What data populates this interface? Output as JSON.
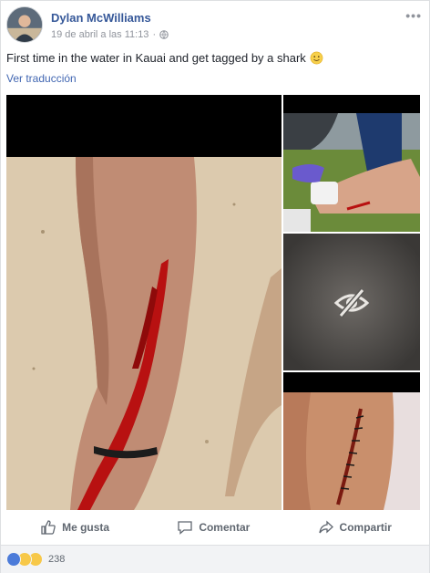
{
  "post": {
    "author": "Dylan McWilliams",
    "timestamp": "19 de abril a las 11:13",
    "privacy_icon": "globe-icon",
    "text": "First time in the water in Kauai and get tagged by a shark",
    "emoji": "slightly-smiling-face",
    "translate_link": "Ver traducción"
  },
  "photos": [
    {
      "id": "main",
      "description_icon": "leg-wound-photo"
    },
    {
      "id": "top",
      "description_icon": "medic-photo"
    },
    {
      "id": "mid",
      "description_icon": "hidden-photo"
    },
    {
      "id": "bot",
      "description_icon": "stitches-photo"
    }
  ],
  "actions": {
    "like_label": "Me gusta",
    "comment_label": "Comentar",
    "share_label": "Compartir"
  },
  "reactions": {
    "count": "238",
    "types": [
      "like",
      "wow",
      "haha"
    ]
  },
  "colors": {
    "link": "#365899",
    "accent": "#4267b2",
    "muted": "#90949c"
  }
}
